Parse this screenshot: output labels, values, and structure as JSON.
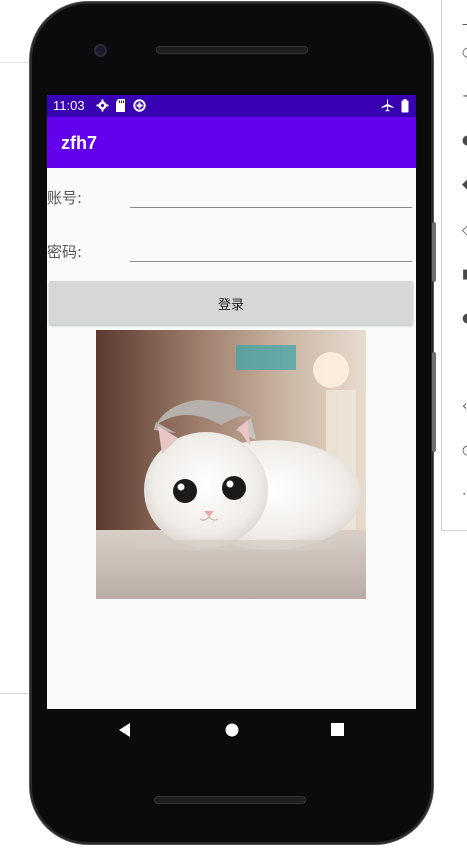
{
  "app": {
    "title": "zfh7"
  },
  "status_bar": {
    "time": "11:03",
    "icons": [
      "settings-icon",
      "sd-card-icon",
      "data-saver-icon",
      "airplane-mode-icon",
      "battery-icon"
    ],
    "color": "#3700b3"
  },
  "app_bar": {
    "color": "#6200ee"
  },
  "form": {
    "account_label": "账号:",
    "account_value": "",
    "password_label": "密码:",
    "password_value": "",
    "login_label": "登录"
  },
  "image": {
    "subject": "white-gray kitten"
  },
  "nav_bar": {
    "icons": [
      "back-icon",
      "home-icon",
      "recents-icon"
    ]
  }
}
